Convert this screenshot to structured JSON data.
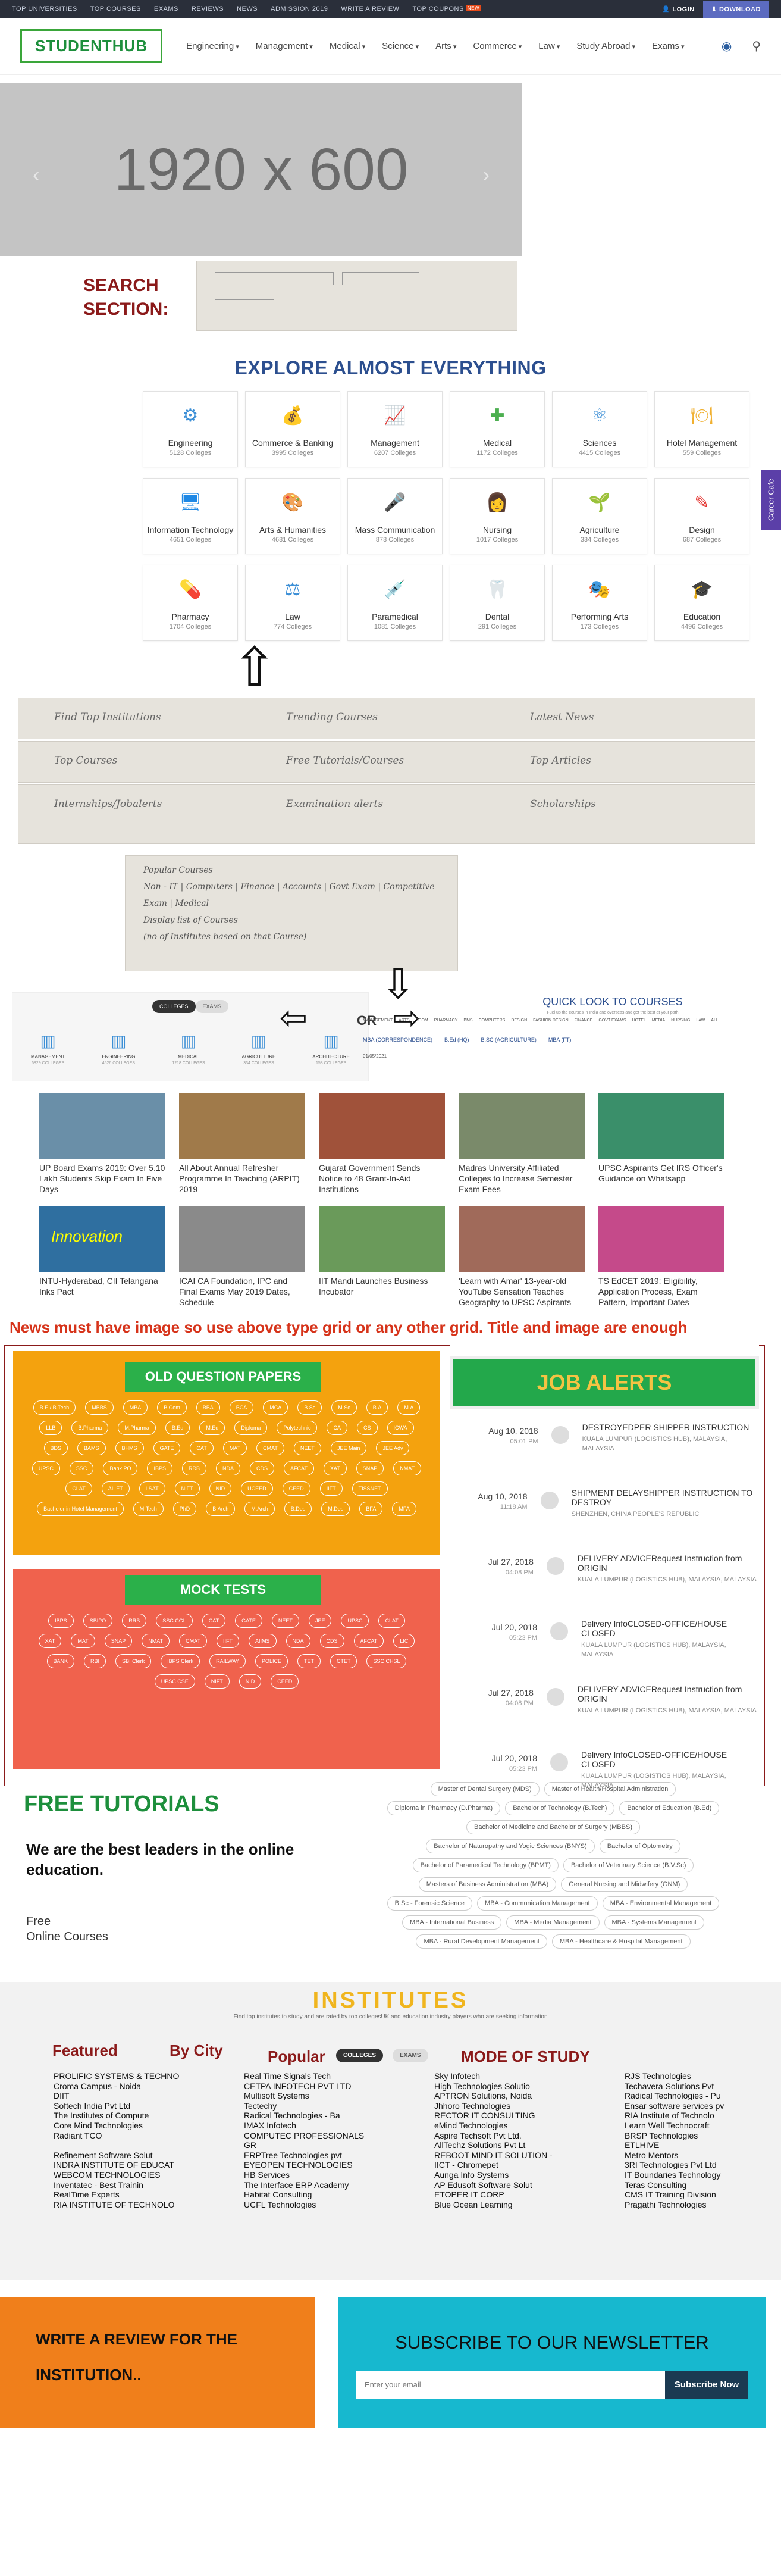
{
  "topbar": {
    "links": [
      "TOP UNIVERSITIES",
      "TOP COURSES",
      "EXAMS",
      "REVIEWS",
      "NEWS",
      "ADMISSION 2019",
      "WRITE A REVIEW",
      "TOP COUPONS"
    ],
    "new_badge": "NEW",
    "login": "LOGIN",
    "download": "DOWNLOAD"
  },
  "nav": {
    "logo": "STUDENTHUB",
    "menu": [
      "Engineering",
      "Management",
      "Medical",
      "Science",
      "Arts",
      "Commerce",
      "Law",
      "Study Abroad",
      "Exams"
    ]
  },
  "hero": {
    "placeholder": "1920 x 600",
    "prev": "‹",
    "next": "›"
  },
  "search": {
    "label": "SEARCH\nSECTION:",
    "sketch_note": "Search Section"
  },
  "explore": {
    "title": "EXPLORE ALMOST EVERYTHING",
    "categories": [
      {
        "name": "Engineering",
        "count": "5128 Colleges",
        "icon": "gear-icon",
        "color": "#3c8fd6",
        "glyph": "⚙"
      },
      {
        "name": "Commerce & Banking",
        "count": "3995 Colleges",
        "icon": "money-bag-icon",
        "color": "#e69a1c",
        "glyph": "💰"
      },
      {
        "name": "Management",
        "count": "6207 Colleges",
        "icon": "chart-icon",
        "color": "#f0a030",
        "glyph": "📈"
      },
      {
        "name": "Medical",
        "count": "1172 Colleges",
        "icon": "medical-kit-icon",
        "color": "#4caf50",
        "glyph": "✚"
      },
      {
        "name": "Sciences",
        "count": "4415 Colleges",
        "icon": "atom-icon",
        "color": "#3c8fd6",
        "glyph": "⚛"
      },
      {
        "name": "Hotel Management",
        "count": "559 Colleges",
        "icon": "food-cover-icon",
        "color": "#f0b030",
        "glyph": "🍽"
      },
      {
        "name": "Information Technology",
        "count": "4651 Colleges",
        "icon": "monitor-icon",
        "color": "#1e88e5",
        "glyph": "🖥"
      },
      {
        "name": "Arts & Humanities",
        "count": "4681 Colleges",
        "icon": "palette-icon",
        "color": "#ef6c00",
        "glyph": "🎨"
      },
      {
        "name": "Mass Communication",
        "count": "878 Colleges",
        "icon": "microphone-icon",
        "color": "#e53935",
        "glyph": "🎤"
      },
      {
        "name": "Nursing",
        "count": "1017 Colleges",
        "icon": "nurse-icon",
        "color": "#26a69a",
        "glyph": "👩"
      },
      {
        "name": "Agriculture",
        "count": "334 Colleges",
        "icon": "leaf-icon",
        "color": "#43a047",
        "glyph": "🌱"
      },
      {
        "name": "Design",
        "count": "687 Colleges",
        "icon": "design-icon",
        "color": "#e53935",
        "glyph": "✎"
      },
      {
        "name": "Pharmacy",
        "count": "1704 Colleges",
        "icon": "pills-icon",
        "color": "#e53935",
        "glyph": "💊"
      },
      {
        "name": "Law",
        "count": "774 Colleges",
        "icon": "scale-icon",
        "color": "#3c8fd6",
        "glyph": "⚖"
      },
      {
        "name": "Paramedical",
        "count": "1081 Colleges",
        "icon": "syringe-icon",
        "color": "#e53935",
        "glyph": "💉"
      },
      {
        "name": "Dental",
        "count": "291 Colleges",
        "icon": "tooth-icon",
        "color": "#3c8fd6",
        "glyph": "🦷"
      },
      {
        "name": "Performing Arts",
        "count": "173 Colleges",
        "icon": "masks-icon",
        "color": "#f0a030",
        "glyph": "🎭"
      },
      {
        "name": "Education",
        "count": "4496 Colleges",
        "icon": "education-icon",
        "color": "#3c8fd6",
        "glyph": "🎓"
      }
    ],
    "side_tab": "Career Cafe"
  },
  "sketches": {
    "row1": [
      "Find Top Institutions",
      "Trending Courses",
      "Latest News"
    ],
    "row2": [
      "Top Courses",
      "Free Tutorials/Courses",
      "Top Articles"
    ],
    "row3": [
      "Internships/Jobalerts",
      "Examination alerts",
      "Scholarships"
    ],
    "popular_box": [
      "Popular Courses",
      "Non - IT | Computers | Finance | Accounts | Govt Exam | Competitive Exam | Medical",
      "Display list of Courses",
      "(no of Institutes based on that Course)"
    ],
    "or": "OR"
  },
  "alt_grid": {
    "tabs": [
      "COLLEGES",
      "EXAMS"
    ],
    "items": [
      {
        "name": "MANAGEMENT",
        "count": "6829 COLLEGES"
      },
      {
        "name": "ENGINEERING",
        "count": "4526 COLLEGES"
      },
      {
        "name": "MEDICAL",
        "count": "1218 COLLEGES"
      },
      {
        "name": "AGRICULTURE",
        "count": "334 COLLEGES"
      },
      {
        "name": "ARCHITECTURE",
        "count": "158 COLLEGES"
      }
    ],
    "quick_title": "QUICK LOOK TO COURSES",
    "quick_sub": "Fuel up the courses in India and overseas and get the best at your path",
    "quick_tabs": [
      "MANAGEMENT",
      "ARTS",
      "BCOM",
      "PHARMACY",
      "BMS",
      "COMPUTERS",
      "DESIGN",
      "FASHION DESIGN",
      "FINANCE",
      "GOVT EXAMS",
      "HOTEL",
      "MEDIA",
      "NURSING",
      "LAW",
      "ALL"
    ],
    "quick_links": [
      "MBA (CORRESPONDENCE)",
      "B.Ed (HQ)",
      "B.SC (AGRICULTURE)",
      "MBA (FT)"
    ],
    "date": "01/05/2021"
  },
  "latest_news": {
    "title": "Latest News",
    "items": [
      {
        "title": "UP Board Exams 2019: Over 5.10 Lakh Students Skip Exam In Five Days",
        "color": "#6a8fa8"
      },
      {
        "title": "All About Annual Refresher Programme In Teaching (ARPIT) 2019",
        "color": "#a07a4a"
      },
      {
        "title": "Gujarat Government Sends Notice to 48 Grant-In-Aid Institutions",
        "color": "#a0523a"
      },
      {
        "title": "Madras University Affiliated Colleges to Increase Semester Exam Fees",
        "color": "#7a8a6a"
      },
      {
        "title": "UPSC Aspirants Get IRS Officer's Guidance on Whatsapp",
        "color": "#3a8f6a"
      },
      {
        "title": "INTU-Hyderabad, CII Telangana Inks Pact",
        "color": "#2f6fa0"
      },
      {
        "title": "ICAI CA Foundation, IPC and Final Exams May 2019 Dates, Schedule",
        "color": "#8a8a8a"
      },
      {
        "title": "IIT Mandi Launches Business Incubator",
        "color": "#6a9a5a"
      },
      {
        "title": "'Learn with Amar' 13-year-old YouTube Sensation Teaches Geography to UPSC Aspirants",
        "color": "#a06a5a"
      },
      {
        "title": "TS EdCET 2019: Eligibility, Application Process, Exam Pattern, Important Dates",
        "color": "#c54a8a"
      }
    ],
    "innovation_text": "Innovation",
    "instruction": "News must have image so use above type grid or any other grid. Title and image are enough"
  },
  "old_papers": {
    "title": "OLD QUESTION PAPERS",
    "pills": [
      "B.E / B.Tech",
      "MBBS",
      "MBA",
      "B.Com",
      "BBA",
      "BCA",
      "MCA",
      "B.Sc",
      "M.Sc",
      "B.A",
      "M.A",
      "LLB",
      "B.Pharma",
      "M.Pharma",
      "B.Ed",
      "M.Ed",
      "Diploma",
      "Polytechnic",
      "CA",
      "CS",
      "ICWA",
      "BDS",
      "BAMS",
      "BHMS",
      "GATE",
      "CAT",
      "MAT",
      "CMAT",
      "NEET",
      "JEE Main",
      "JEE Adv",
      "UPSC",
      "SSC",
      "Bank PO",
      "IBPS",
      "RRB",
      "NDA",
      "CDS",
      "AFCAT",
      "XAT",
      "SNAP",
      "NMAT",
      "CLAT",
      "AILET",
      "LSAT",
      "NIFT",
      "NID",
      "UCEED",
      "CEED",
      "IIFT",
      "TISSNET",
      "Bachelor in Hotel Management",
      "M.Tech",
      "PhD",
      "B.Arch",
      "M.Arch",
      "B.Des",
      "M.Des",
      "BFA",
      "MFA"
    ]
  },
  "mock_tests": {
    "title": "MOCK TESTS",
    "pills": [
      "IBPS",
      "SBIPO",
      "RRB",
      "SSC CGL",
      "CAT",
      "GATE",
      "NEET",
      "JEE",
      "UPSC",
      "CLAT",
      "XAT",
      "MAT",
      "SNAP",
      "NMAT",
      "CMAT",
      "IIFT",
      "AIIMS",
      "NDA",
      "CDS",
      "AFCAT",
      "LIC",
      "BANK",
      "RBI",
      "SBI Clerk",
      "IBPS Clerk",
      "RAILWAY",
      "POLICE",
      "TET",
      "CTET",
      "SSC CHSL",
      "UPSC CSE",
      "NIFT",
      "NID",
      "CEED"
    ]
  },
  "job_alerts": {
    "title": "JOB ALERTS",
    "items": [
      {
        "date": "Aug 10, 2018",
        "time": "05:01 PM",
        "title": "DESTROYEDPER SHIPPER INSTRUCTION",
        "location": "KUALA LUMPUR (LOGISTICS HUB), MALAYSIA, MALAYSIA"
      },
      {
        "date": "Aug 10, 2018",
        "time": "11:18 AM",
        "title": "SHIPMENT DELAYSHIPPER INSTRUCTION TO DESTROY",
        "location": "SHENZHEN, CHINA PEOPLE'S REPUBLIC"
      },
      {
        "date": "Jul 27, 2018",
        "time": "04:08 PM",
        "title": "DELIVERY ADVICERequest Instruction from ORIGIN",
        "location": "KUALA LUMPUR (LOGISTICS HUB), MALAYSIA, MALAYSIA"
      },
      {
        "date": "Jul 20, 2018",
        "time": "05:23 PM",
        "title": "Delivery InfoCLOSED-OFFICE/HOUSE CLOSED",
        "location": "KUALA LUMPUR (LOGISTICS HUB), MALAYSIA, MALAYSIA"
      },
      {
        "date": "Jul 27, 2018",
        "time": "04:08 PM",
        "title": "DELIVERY ADVICERequest Instruction from ORIGIN",
        "location": "KUALA LUMPUR (LOGISTICS HUB), MALAYSIA, MALAYSIA"
      },
      {
        "date": "Jul 20, 2018",
        "time": "05:23 PM",
        "title": "Delivery InfoCLOSED-OFFICE/HOUSE CLOSED",
        "location": "KUALA LUMPUR (LOGISTICS HUB), MALAYSIA, MALAYSIA"
      }
    ]
  },
  "tutorials": {
    "title": "FREE TUTORIALS",
    "lead": "We are the best leaders in the online education.",
    "free": "Free\nOnline Courses",
    "tags": [
      "Master of Dental Surgery (MDS)",
      "Master of Health/Hospital Administration",
      "Diploma in Pharmacy (D.Pharma)",
      "Bachelor of Technology (B.Tech)",
      "Bachelor of Education (B.Ed)",
      "Bachelor of Medicine and Bachelor of Surgery (MBBS)",
      "Bachelor of Naturopathy and Yogic Sciences (BNYS)",
      "Bachelor of Optometry",
      "Bachelor of Paramedical Technology (BPMT)",
      "Bachelor of Veterinary Science (B.V.Sc)",
      "Masters of Business Administration (MBA)",
      "General Nursing and Midwifery (GNM)",
      "B.Sc - Forensic Science",
      "MBA - Communication Management",
      "MBA - Environmental Management",
      "MBA - International Business",
      "MBA - Media Management",
      "MBA - Systems Management",
      "MBA - Rural Development Management",
      "MBA - Healthcare & Hospital Management"
    ]
  },
  "institutes": {
    "title": "INSTITUTES",
    "sub": "Find top institutes to study and are rated by top collegesUK and education industry players who are seeking information",
    "labels": {
      "featured": "Featured",
      "city": "By City",
      "popular": "Popular",
      "mode": "MODE OF STUDY"
    },
    "tabs": [
      "COLLEGES",
      "EXAMS"
    ],
    "col1": [
      "PROLIFIC SYSTEMS & TECHNO",
      "Croma Campus - Noida",
      "DIIT",
      "Softech India Pvt Ltd",
      "The Institutes of Compute",
      "Core Mind Technologies",
      "Radiant TCO",
      "",
      "Refinement Software Solut",
      "INDRA INSTITUTE OF EDUCAT",
      "WEBCOM TECHNOLOGIES",
      "Inventatec - Best Trainin",
      "RealTime Experts",
      "RIA INSTITUTE OF TECHNOLO"
    ],
    "col2": [
      "Real Time Signals Tech",
      "CETPA INFOTECH PVT LTD",
      "Multisoft Systems",
      "Tectechy",
      "Radical Technologies - Ba",
      "IMAX Infotech",
      "COMPUTEC PROFESSIONALS",
      "GR",
      "ERPTree Technologies pvt",
      "EYEOPEN TECHNOLOGIES",
      "HB Services",
      "The Interface ERP Academy",
      "Habitat Consulting",
      "UCFL Technologies"
    ],
    "col3": [
      "Sky Infotech",
      "High Technologies Solutio",
      "APTRON Solutions, Noida",
      "Jhhoro Technologies",
      "RECTOR IT CONSULTING",
      "eMind Technologies",
      "Aspire Techsoft Pvt Ltd.",
      "AllTechz Solutions Pvt Lt",
      "REBOOT MIND IT SOLUTION -",
      "IICT - Chromepet",
      "Aunga Info Systems",
      "AP Edusoft Software Solut",
      "ETOPER IT CORP",
      "Blue Ocean Learning"
    ],
    "col4": [
      "RJS Technologies",
      "Techavera Solutions Pvt",
      "Radical Technologies - Pu",
      "Ensar software services pv",
      "RIA Institute of Technolo",
      "Learn Well Technocraft",
      "BRSP Technologies",
      "ETLHIVE",
      "Metro Mentors",
      "3RI Technologies Pvt Ltd",
      "IT Boundaries Technology",
      "Teras Consulting",
      "CMS IT Training Division",
      "Pragathi Technologies"
    ]
  },
  "cta": {
    "review": "WRITE A REVIEW FOR THE INSTITUTION..",
    "newsletter_title": "SUBSCRIBE TO OUR NEWSLETTER",
    "email_placeholder": "Enter your email",
    "subscribe": "Subscribe Now"
  }
}
